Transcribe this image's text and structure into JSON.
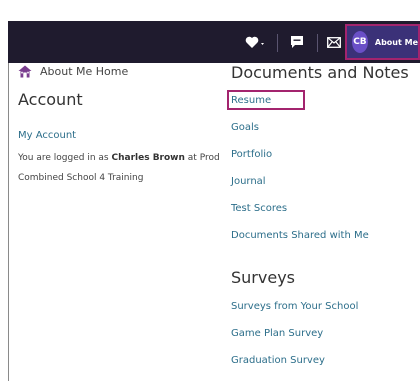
{
  "header": {
    "avatar_initials": "CB",
    "user_menu_label": "About Me",
    "icons": {
      "heart": "heart-icon",
      "chat": "chat-icon",
      "mail": "mail-icon",
      "caret": "chevron-down-icon"
    }
  },
  "menu": {
    "home_link": "About Me Home",
    "account_title": "Account",
    "my_account": "My Account",
    "logged_in_prefix": "You are logged in as",
    "user_name": "Charles Brown",
    "at_text": "at",
    "school": "Prod Combined School 4 Training",
    "documents_title": "Documents and Notes",
    "documents": [
      "Resume",
      "Goals",
      "Portfolio",
      "Journal",
      "Test Scores",
      "Documents Shared with Me"
    ],
    "surveys_title": "Surveys",
    "surveys": [
      "Surveys from Your School",
      "Game Plan Survey",
      "Graduation Survey"
    ]
  },
  "colors": {
    "topbar": "#1f1b2e",
    "user_button": "#3b3178",
    "highlight": "#a3246e",
    "link": "#2c6e8a"
  }
}
